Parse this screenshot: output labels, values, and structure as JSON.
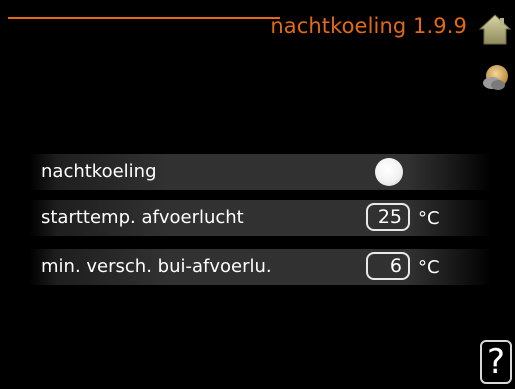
{
  "header": {
    "title": "nachtkoeling 1.9.9",
    "accent_color": "#e36a12",
    "home_icon": "home-icon",
    "outdoor_icon": "outdoor-sensor-icon"
  },
  "settings": [
    {
      "label": "nachtkoeling",
      "type": "toggle",
      "state": "off"
    },
    {
      "label": "starttemp. afvoerlucht",
      "type": "number",
      "value": "25",
      "unit": "°C"
    },
    {
      "label": "min. versch. bui-afvoerlu.",
      "type": "number",
      "value": "6",
      "unit": "°C"
    }
  ],
  "footer": {
    "help_label": "?"
  }
}
